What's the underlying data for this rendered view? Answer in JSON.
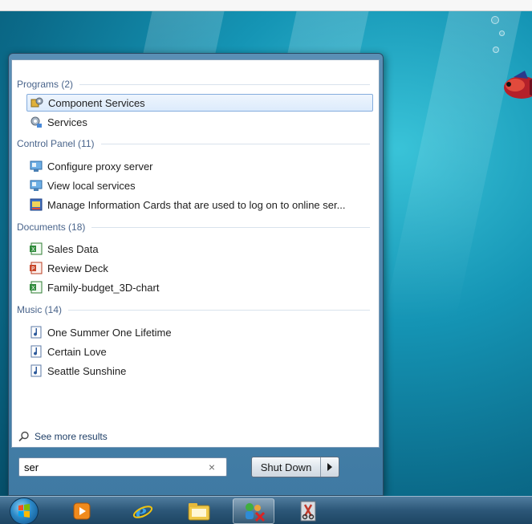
{
  "desktop": {
    "accent": "#1595b5"
  },
  "results": {
    "groups": [
      {
        "header": "Programs (2)",
        "items": [
          {
            "label": "Component Services",
            "icon": "component-services-icon",
            "selected": true
          },
          {
            "label": "Services",
            "icon": "services-gear-icon",
            "selected": false
          }
        ]
      },
      {
        "header": "Control Panel (11)",
        "items": [
          {
            "label": "Configure proxy server",
            "icon": "control-panel-icon"
          },
          {
            "label": "View local services",
            "icon": "control-panel-icon"
          },
          {
            "label": "Manage Information Cards that are used to log on to online ser...",
            "icon": "information-cards-icon"
          }
        ]
      },
      {
        "header": "Documents (18)",
        "items": [
          {
            "label": "Sales Data",
            "icon": "excel-document-icon"
          },
          {
            "label": "Review Deck",
            "icon": "powerpoint-document-icon"
          },
          {
            "label": "Family-budget_3D-chart",
            "icon": "excel-document-icon"
          }
        ]
      },
      {
        "header": "Music (14)",
        "items": [
          {
            "label": "One Summer One Lifetime",
            "icon": "music-file-icon"
          },
          {
            "label": "Certain Love",
            "icon": "music-file-icon"
          },
          {
            "label": "Seattle Sunshine",
            "icon": "music-file-icon"
          }
        ]
      }
    ],
    "see_more": "See more results"
  },
  "search": {
    "value": "ser",
    "clear_icon": "×"
  },
  "shutdown": {
    "label": "Shut Down"
  },
  "taskbar": {
    "items": [
      {
        "icon": "windows-start-orb-icon"
      },
      {
        "icon": "media-player-icon"
      },
      {
        "icon": "internet-explorer-icon"
      },
      {
        "icon": "file-explorer-icon"
      },
      {
        "icon": "network-people-icon"
      },
      {
        "icon": "snipping-tool-icon"
      }
    ]
  }
}
